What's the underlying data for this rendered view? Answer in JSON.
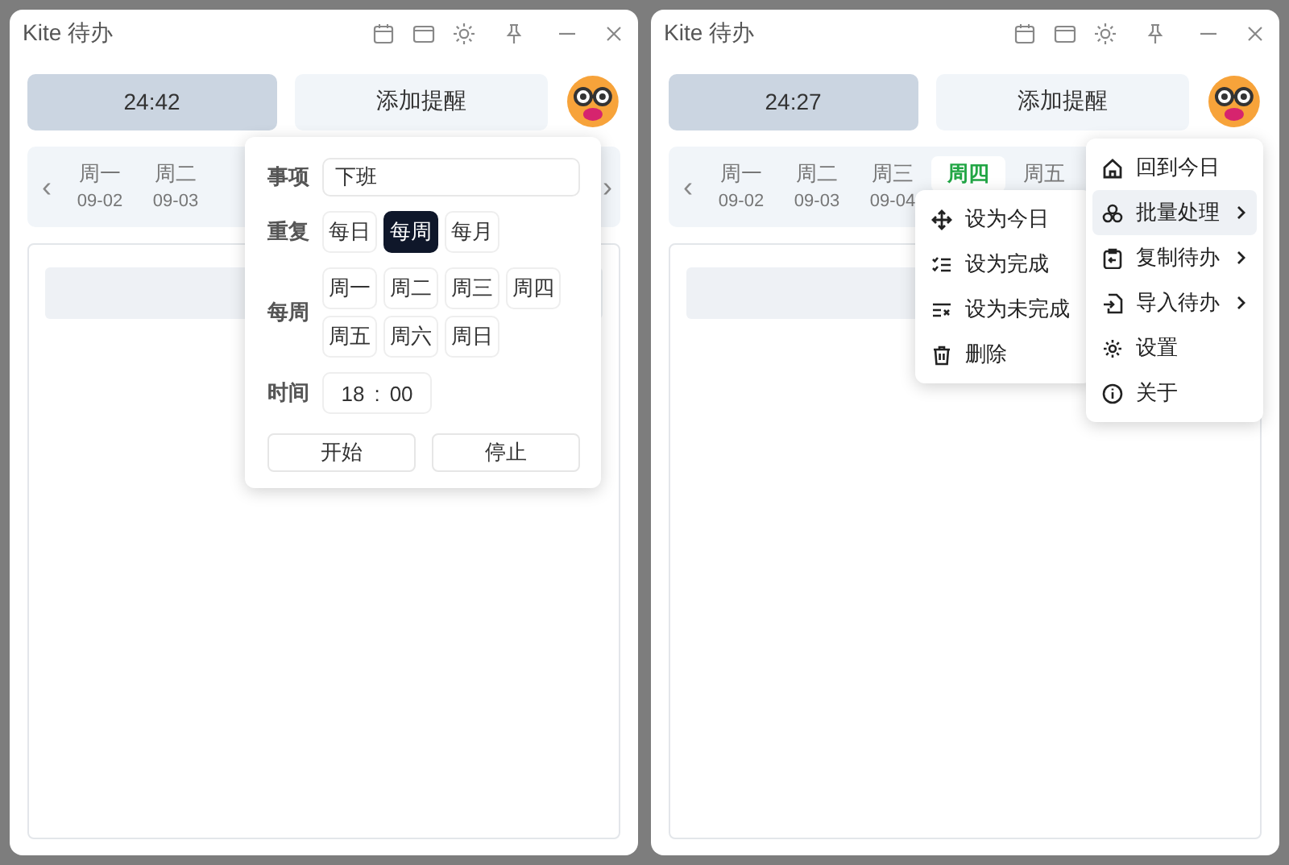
{
  "windows": [
    {
      "title": "Kite 待办",
      "timer": "24:42",
      "add_button": "添加提醒",
      "week": {
        "prev": "‹",
        "next": "›",
        "days": [
          {
            "weekday": "周一",
            "date": "09-02",
            "selected": false
          },
          {
            "weekday": "周二",
            "date": "09-03",
            "selected": false
          }
        ]
      },
      "reminder_popup": {
        "item_label": "事项",
        "item_value": "下班",
        "repeat_label": "重复",
        "repeat_options": [
          {
            "label": "每日",
            "selected": false
          },
          {
            "label": "每周",
            "selected": true
          },
          {
            "label": "每月",
            "selected": false
          }
        ],
        "weekday_label": "每周",
        "weekdays": [
          {
            "label": "周一",
            "selected": false
          },
          {
            "label": "周二",
            "selected": false
          },
          {
            "label": "周三",
            "selected": false
          },
          {
            "label": "周四",
            "selected": false
          },
          {
            "label": "周五",
            "selected": false
          },
          {
            "label": "周六",
            "selected": false
          },
          {
            "label": "周日",
            "selected": false
          }
        ],
        "time_label": "时间",
        "hour": "18",
        "separator": ":",
        "minute": "00",
        "buttons": [
          "开始",
          "停止"
        ]
      }
    },
    {
      "title": "Kite 待办",
      "timer": "24:27",
      "add_button": "添加提醒",
      "week": {
        "prev": "‹",
        "days": [
          {
            "weekday": "周一",
            "date": "09-02",
            "selected": false
          },
          {
            "weekday": "周二",
            "date": "09-03",
            "selected": false
          },
          {
            "weekday": "周三",
            "date": "09-04",
            "selected": false
          },
          {
            "weekday": "周四",
            "selected": true
          },
          {
            "weekday": "周五",
            "selected": false
          }
        ]
      },
      "menu": {
        "items": [
          {
            "label": "回到今日",
            "submenu": false,
            "selected": false
          },
          {
            "label": "批量处理",
            "submenu": true,
            "selected": true
          },
          {
            "label": "复制待办",
            "submenu": true,
            "selected": false
          },
          {
            "label": "导入待办",
            "submenu": true,
            "selected": false
          },
          {
            "label": "设置",
            "submenu": false,
            "selected": false
          },
          {
            "label": "关于",
            "submenu": false,
            "selected": false
          }
        ],
        "submenu_items": [
          {
            "label": "设为今日"
          },
          {
            "label": "设为完成"
          },
          {
            "label": "设为未完成"
          },
          {
            "label": "删除"
          }
        ]
      }
    }
  ]
}
